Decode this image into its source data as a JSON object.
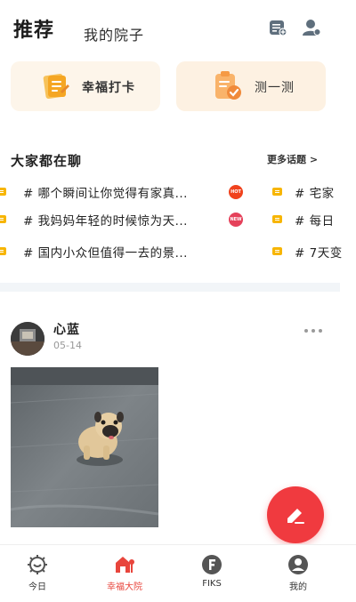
{
  "header": {
    "tab_main": "推荐",
    "tab_sub": "我的院子",
    "icons": [
      "notes-icon",
      "user-icon"
    ]
  },
  "cards": [
    {
      "label": "幸福打卡",
      "icon": "checkin-icon"
    },
    {
      "label": "测一测",
      "icon": "quiz-icon"
    }
  ],
  "topics_section": {
    "title": "大家都在聊",
    "more": "更多话题 >"
  },
  "topics": [
    {
      "left": "# 哪个瞬间让你觉得有家真...",
      "badge": "HOT",
      "right": "# 宅家"
    },
    {
      "left": "# 我妈妈年轻的时候惊为天...",
      "badge": "NEW",
      "right": "# 每日"
    },
    {
      "left": "# 国内小众但值得一去的景...",
      "badge": "",
      "right": "# 7天变"
    }
  ],
  "post": {
    "author": "心蓝",
    "date": "05-14"
  },
  "tabbar": [
    {
      "label": "今日",
      "icon": "today-icon",
      "active": false
    },
    {
      "label": "幸福大院",
      "icon": "courtyard-icon",
      "active": true
    },
    {
      "label": "FIKS",
      "icon": "fiks-icon",
      "active": false
    },
    {
      "label": "我的",
      "icon": "profile-icon",
      "active": false
    }
  ],
  "colors": {
    "accent": "#f03a3f",
    "active_tab": "#e8453c",
    "topic_flag": "#f7b500",
    "card_bg": "#fdf5ea"
  }
}
